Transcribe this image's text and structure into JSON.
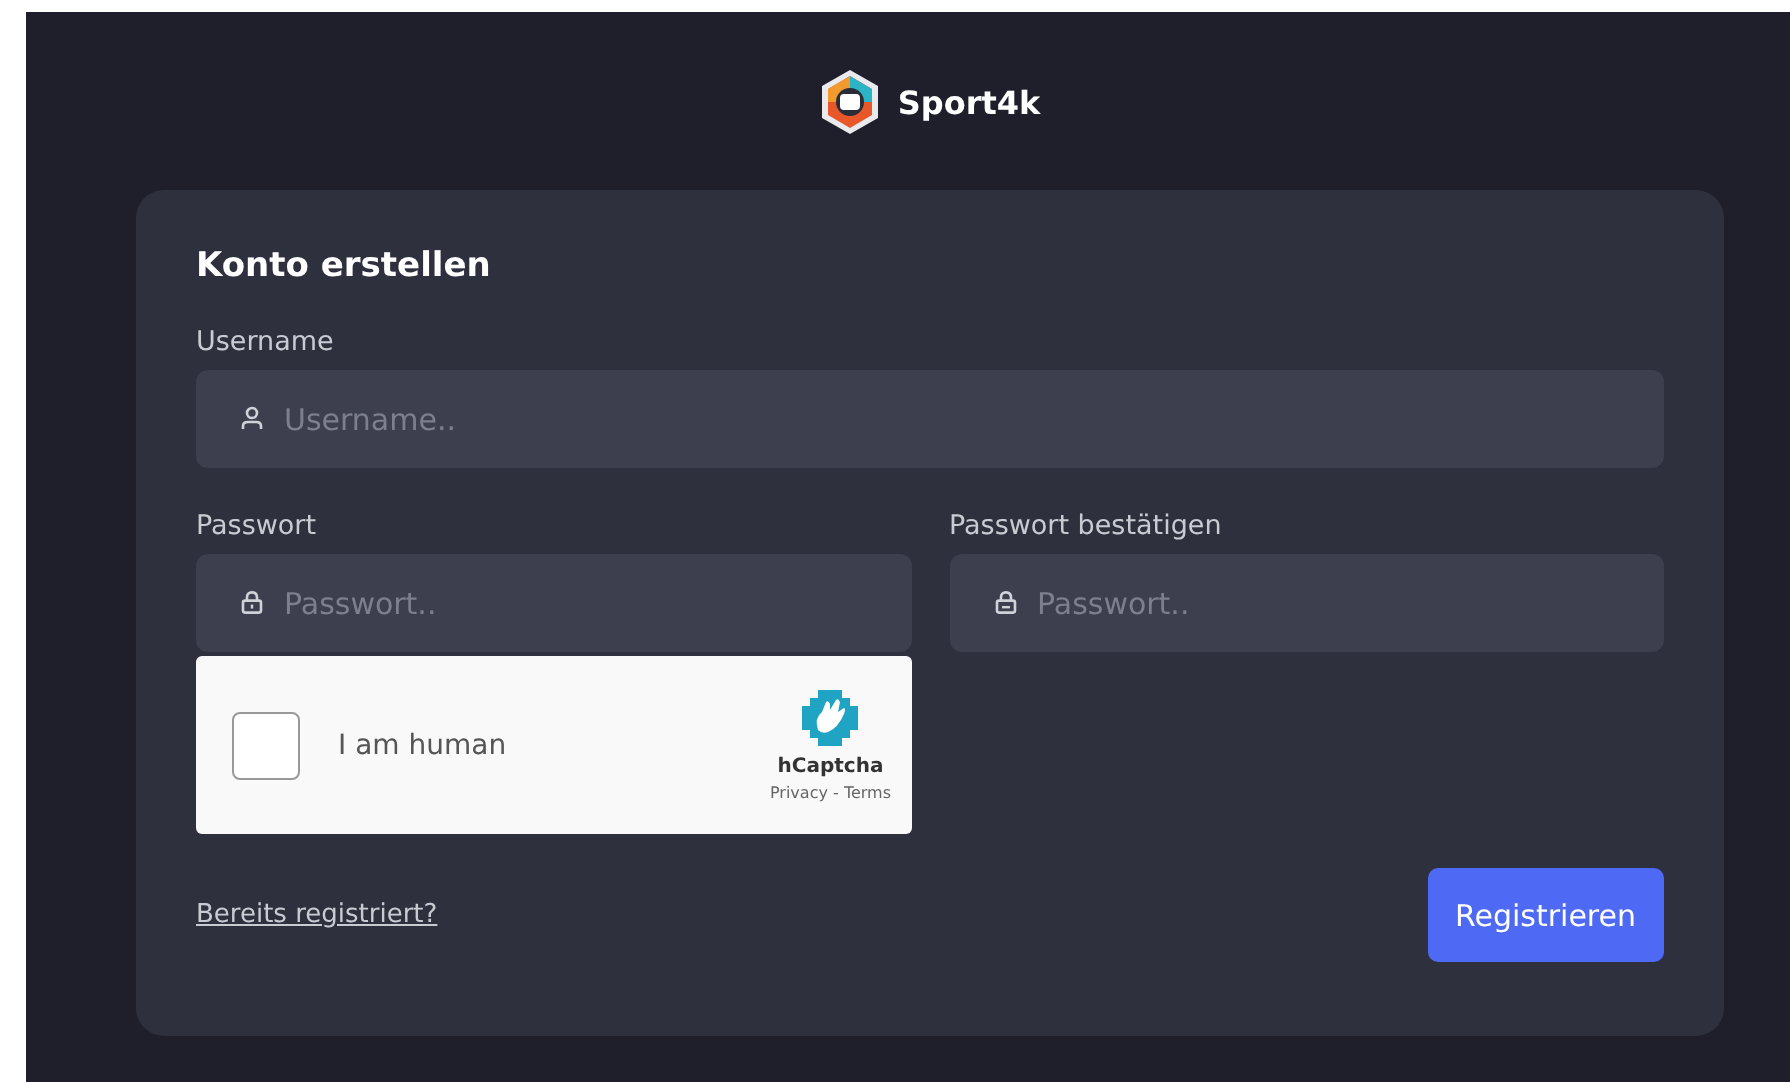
{
  "brand": {
    "name": "Sport4k"
  },
  "form": {
    "title": "Konto erstellen",
    "username": {
      "label": "Username",
      "placeholder": "Username.."
    },
    "password": {
      "label": "Passwort",
      "placeholder": "Passwort.."
    },
    "confirm": {
      "label": "Passwort bestätigen",
      "placeholder": "Passwort.."
    },
    "captcha": {
      "label": "I am human",
      "checked": false,
      "brand": "hCaptcha",
      "privacy": "Privacy",
      "separator": "-",
      "terms": "Terms"
    },
    "login_link": "Bereits registriert?",
    "submit": "Registrieren"
  }
}
